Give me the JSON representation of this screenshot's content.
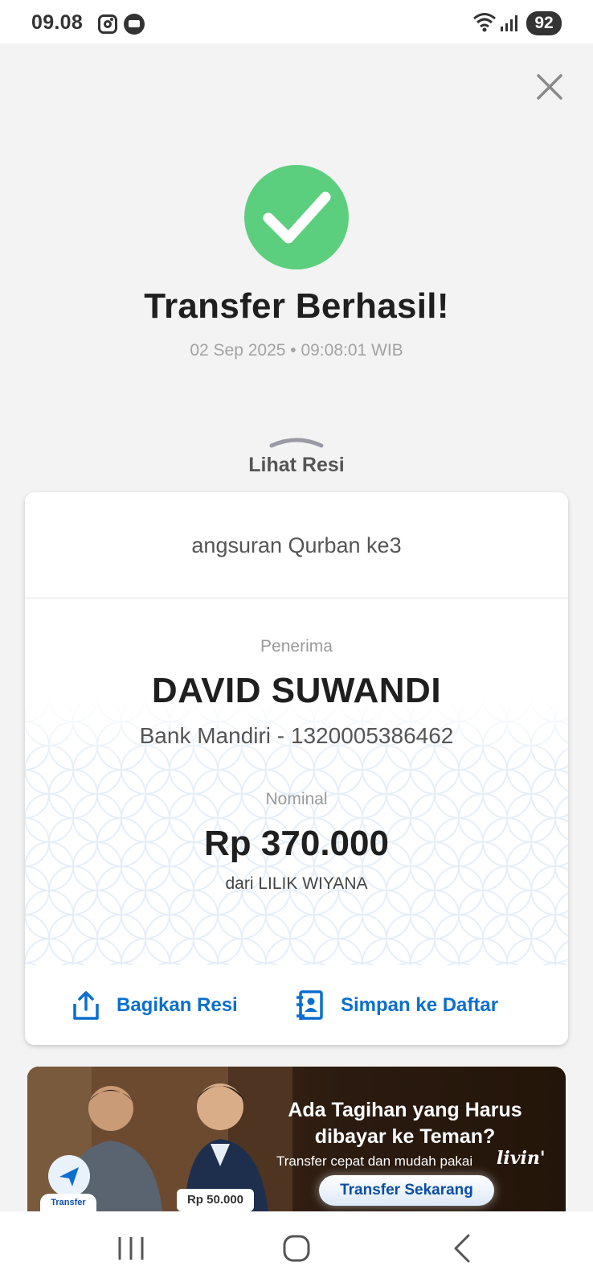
{
  "status_bar": {
    "time": "09.08",
    "battery": "92",
    "icons": [
      "instagram-icon",
      "message-icon",
      "wifi-icon",
      "signal-icon",
      "battery-icon"
    ]
  },
  "header": {
    "close_icon": "close-icon"
  },
  "result": {
    "icon": "check-icon",
    "title": "Transfer Berhasil!",
    "datetime": "02 Sep 2025 • 09:08:01 WIB",
    "view_receipt": "Lihat Resi"
  },
  "receipt": {
    "note": "angsuran Qurban ke3",
    "recipient_label": "Penerima",
    "recipient_name": "DAVID SUWANDI",
    "recipient_bank": "Bank Mandiri - 1320005386462",
    "amount_label": "Nominal",
    "amount": "Rp 370.000",
    "sender": "dari LILIK WIYANA",
    "share_label": "Bagikan Resi",
    "save_label": "Simpan ke Daftar"
  },
  "banner": {
    "title": "Ada Tagihan yang Harus dibayar ke Teman?",
    "subtitle": "Transfer cepat dan mudah pakai",
    "logo": "livin'",
    "cta": "Transfer Sekarang",
    "amount_tag": "Rp 50.000",
    "transfer_tag": "Transfer"
  },
  "colors": {
    "success": "#5ccf7e",
    "accent": "#0a6fcf",
    "background": "#f3f3f3"
  },
  "navbar": {
    "icons": [
      "recent-apps-icon",
      "home-icon",
      "back-icon"
    ]
  }
}
